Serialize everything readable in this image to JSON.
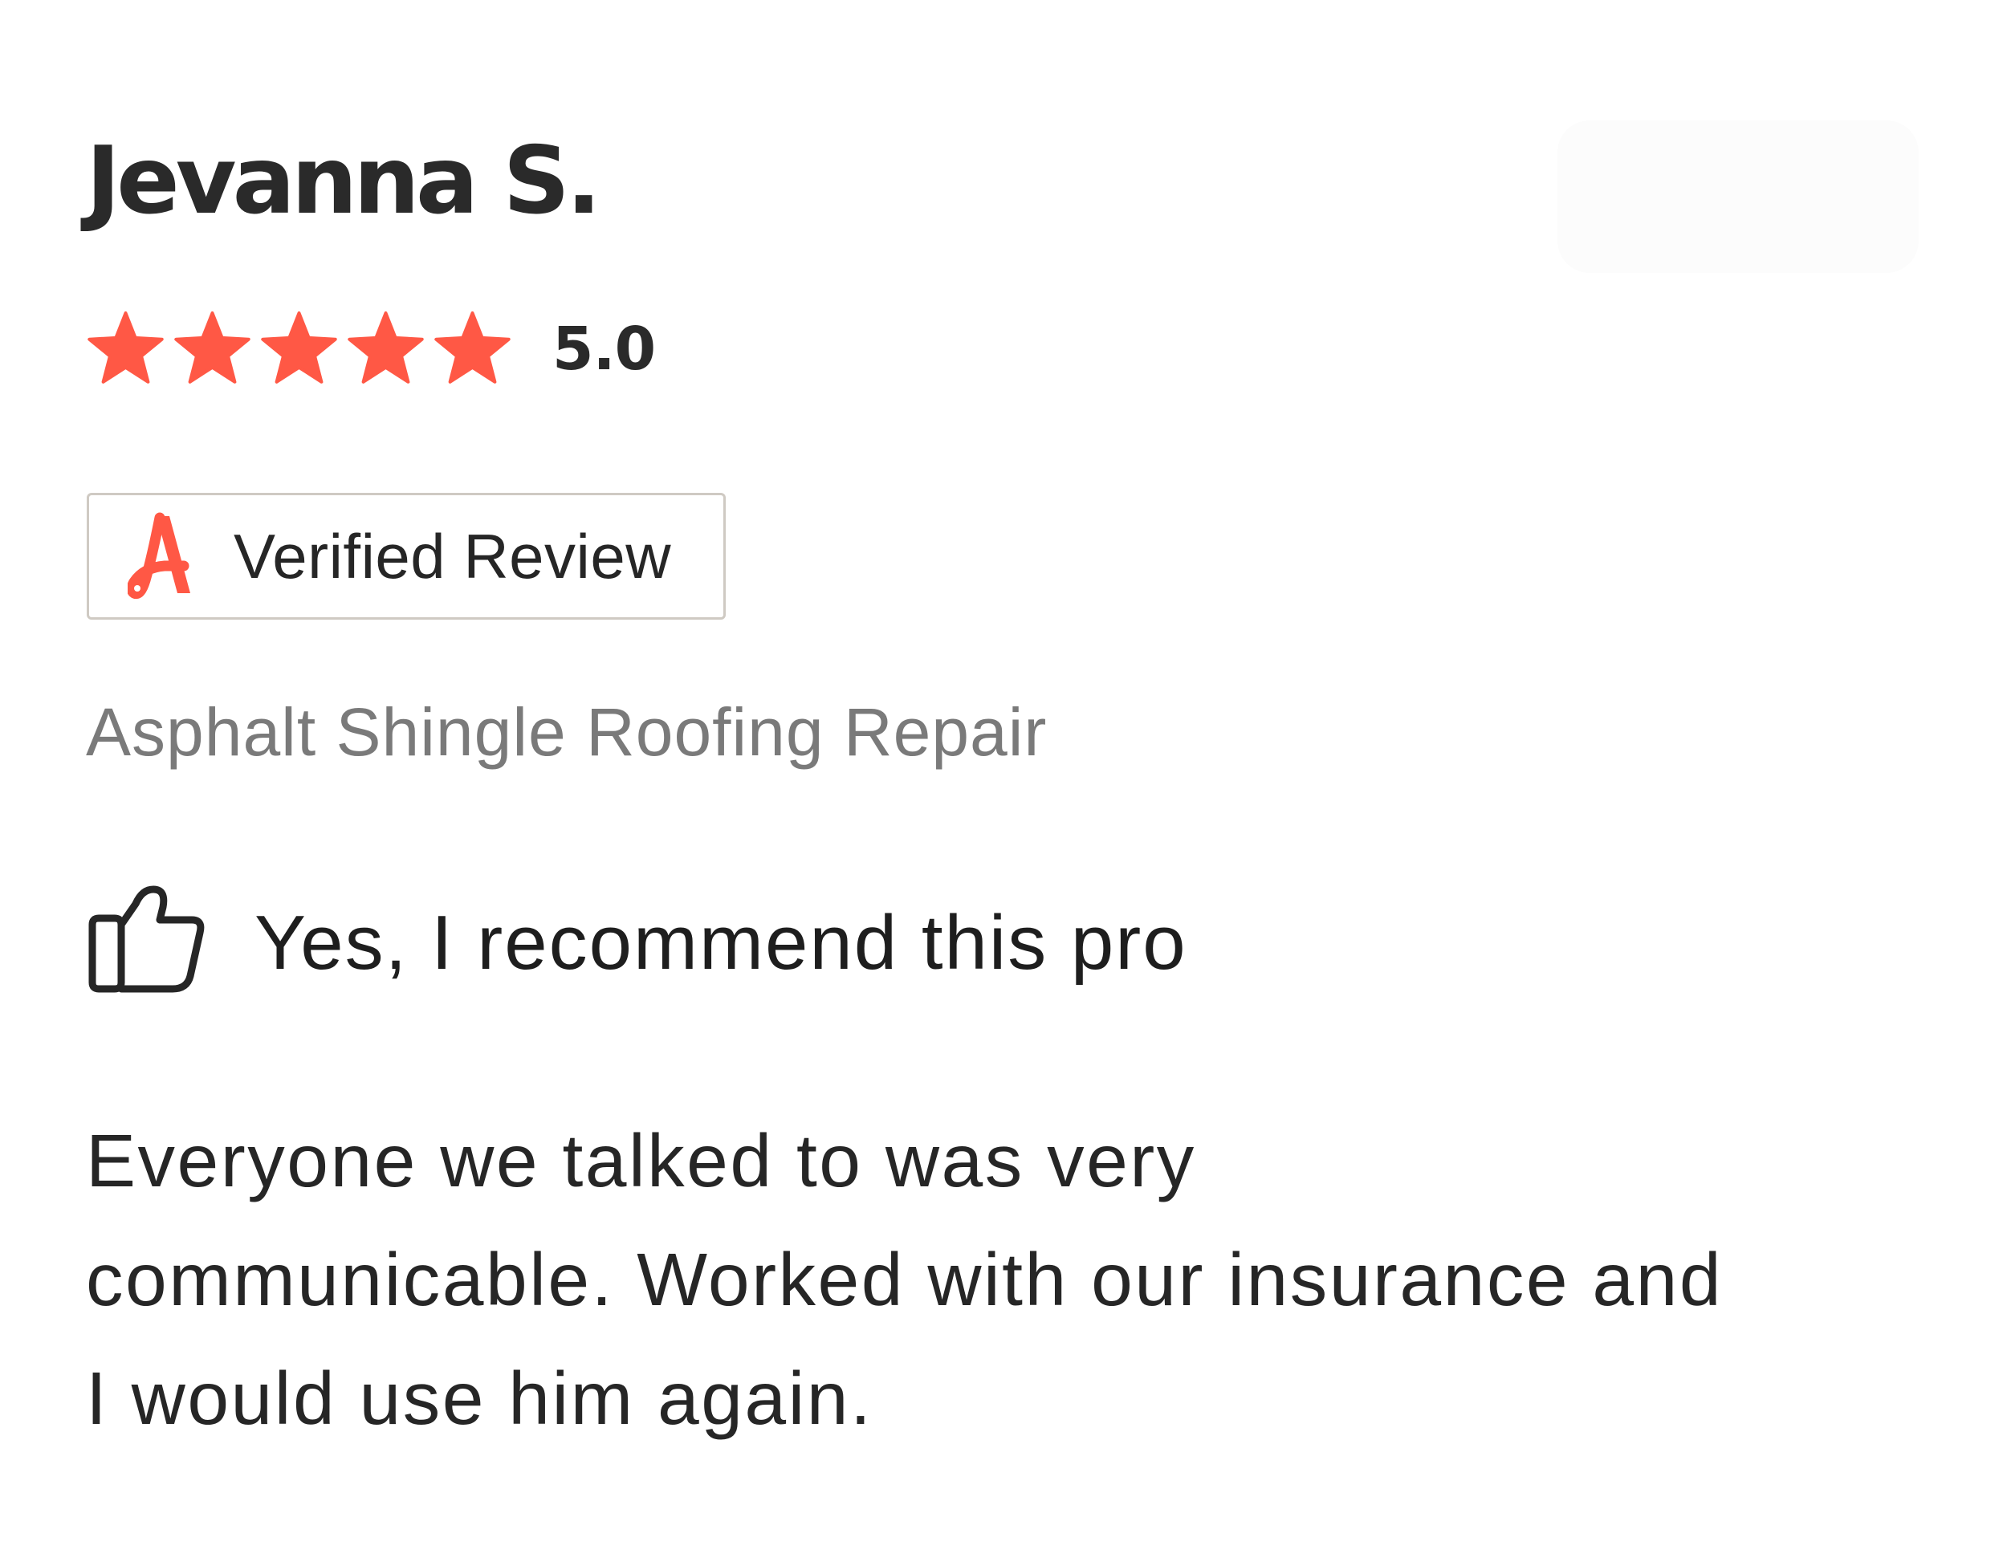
{
  "review": {
    "reviewer_name": "Jevanna S.",
    "rating": 5.0,
    "rating_label": "5.0",
    "star_color": "#ff5845",
    "star_count": 5,
    "filled_stars": 5,
    "badge": {
      "label": "Verified Review",
      "logo_letter": "A",
      "logo_color": "#ff5845"
    },
    "service": "Asphalt Shingle Roofing Repair",
    "recommendation": "Yes, I recommend this pro",
    "recommend_icon": "thumbs-up-icon",
    "body_lines": [
      "Everyone we talked to was very",
      "communicable. Worked with our insurance and",
      "I would use him again."
    ]
  }
}
